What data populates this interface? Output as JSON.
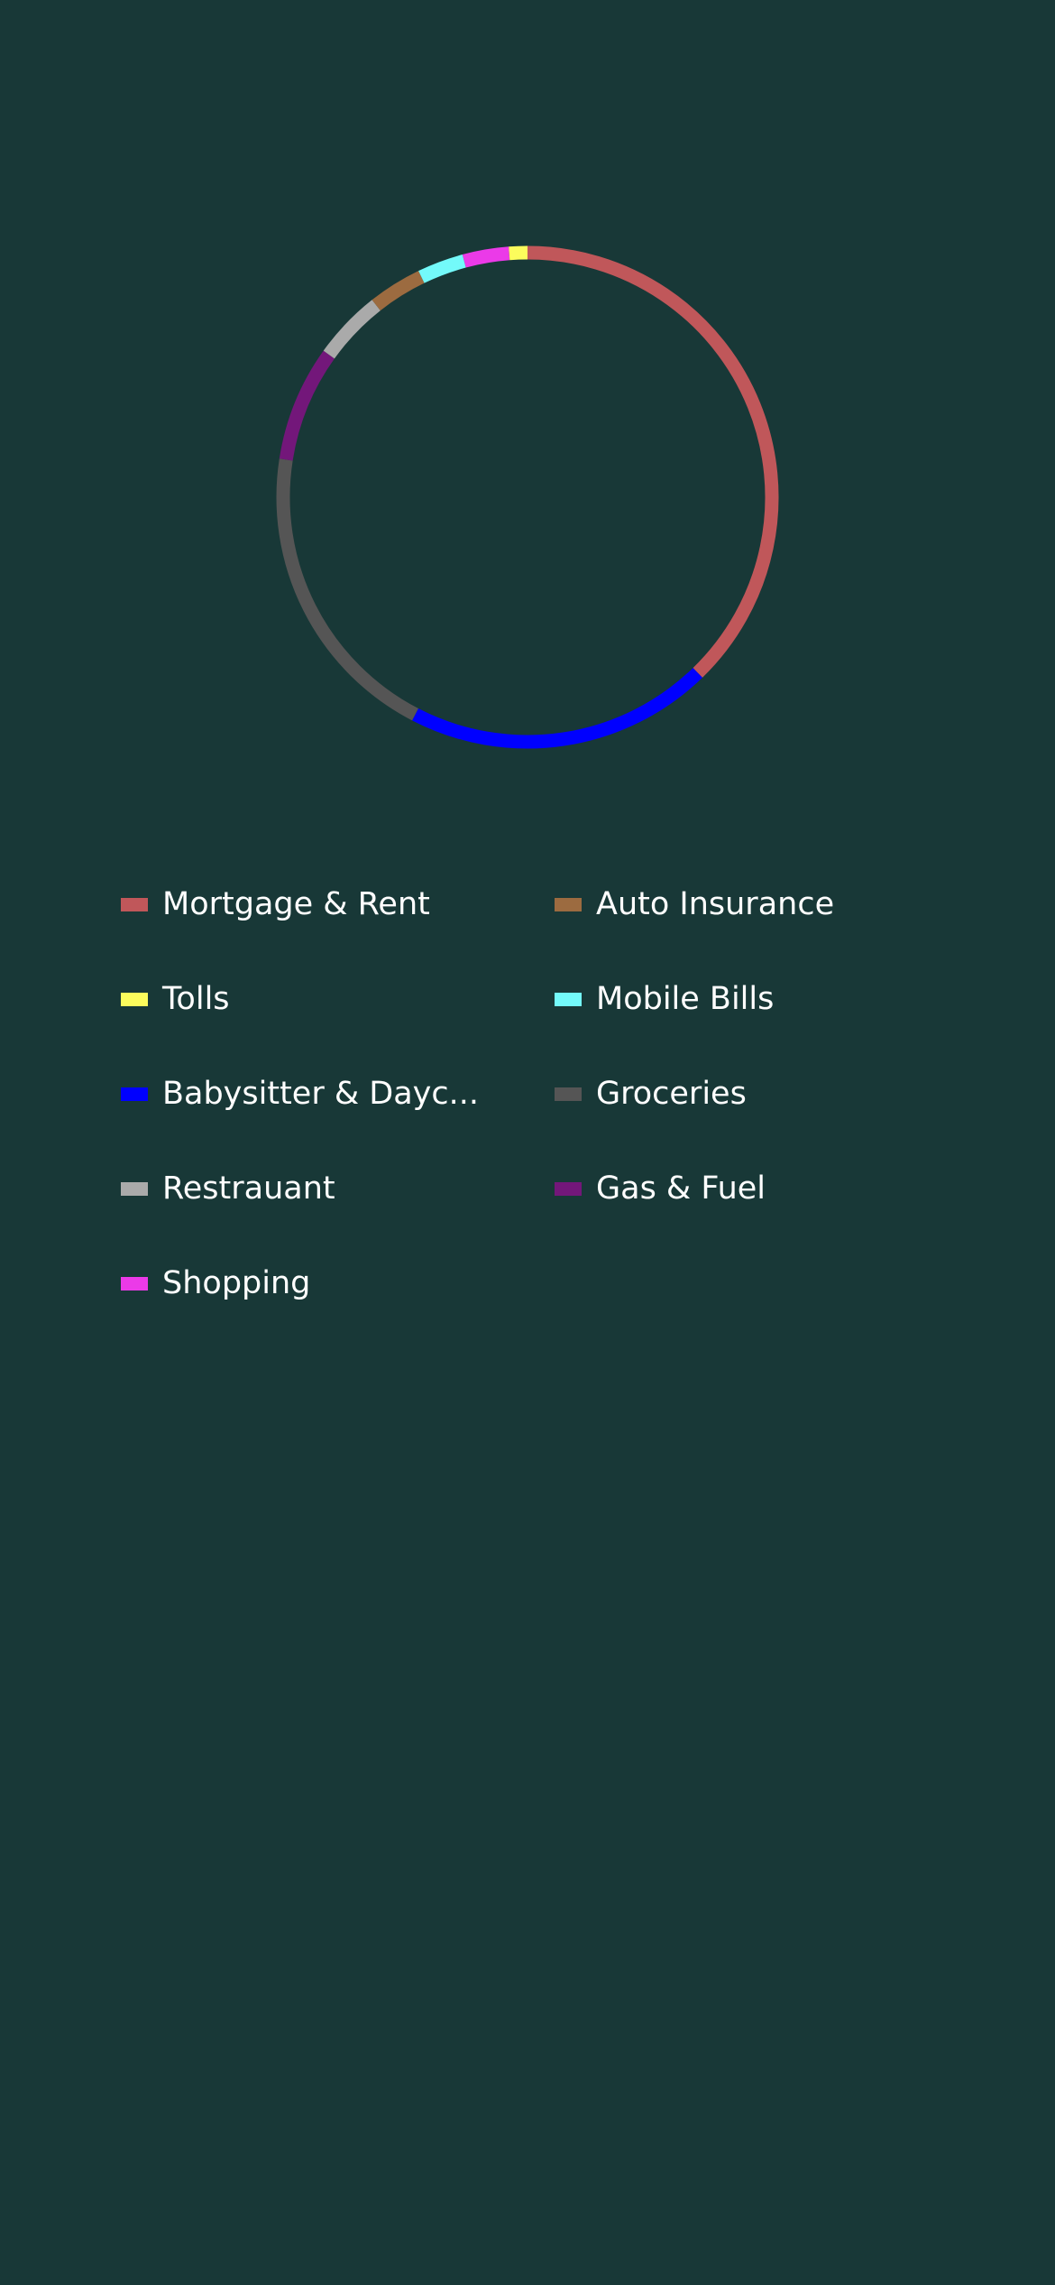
{
  "chart_data": {
    "type": "donut",
    "start_angle_deg": 0,
    "direction": "clockwise",
    "slices": [
      {
        "label": "Mortgage & Rent",
        "value": 38,
        "color": "#c0575a"
      },
      {
        "label": "Babysitter & Dayc...",
        "value": 20,
        "color": "#0000ff"
      },
      {
        "label": "Groceries",
        "value": 20,
        "color": "#555555"
      },
      {
        "label": "Gas & Fuel",
        "value": 7.5,
        "color": "#73177a"
      },
      {
        "label": "Restrauant",
        "value": 4.5,
        "color": "#aaaaaa"
      },
      {
        "label": "Auto Insurance",
        "value": 3.5,
        "color": "#9c6b40"
      },
      {
        "label": "Mobile Bills",
        "value": 3,
        "color": "#73fafa"
      },
      {
        "label": "Shopping",
        "value": 3,
        "color": "#eb3ae8"
      },
      {
        "label": "Tolls",
        "value": 1.2,
        "color": "#fcfc5c"
      }
    ]
  },
  "legend": {
    "items": [
      {
        "label": "Mortgage & Rent",
        "color": "#c0575a"
      },
      {
        "label": "Auto Insurance",
        "color": "#9c6b40"
      },
      {
        "label": "Tolls",
        "color": "#fcfc5c"
      },
      {
        "label": "Mobile Bills",
        "color": "#73fafa"
      },
      {
        "label": "Babysitter & Dayc...",
        "color": "#0000ff"
      },
      {
        "label": "Groceries",
        "color": "#555555"
      },
      {
        "label": "Restrauant",
        "color": "#aaaaaa"
      },
      {
        "label": "Gas & Fuel",
        "color": "#73177a"
      },
      {
        "label": "Shopping",
        "color": "#eb3ae8"
      }
    ]
  },
  "colors": {
    "background": "#183837",
    "label_text": "#ffffff"
  }
}
